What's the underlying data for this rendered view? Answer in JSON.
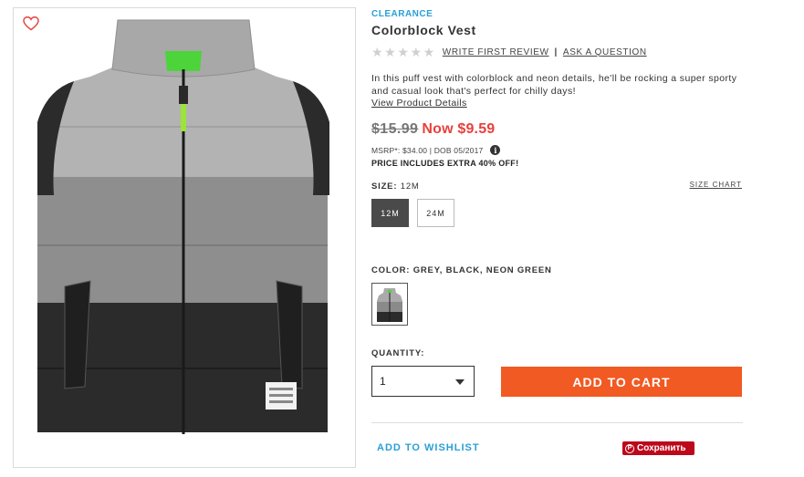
{
  "product": {
    "badge": "CLEARANCE",
    "title": "Colorblock Vest",
    "rating_stars": 0,
    "write_review": "WRITE FIRST REVIEW",
    "separator": "|",
    "ask_question": "ASK A QUESTION",
    "description": "In this puff vest with colorblock and neon details, he'll be rocking a super sporty and casual look that's perfect for chilly days!",
    "details_link": "View Product Details"
  },
  "pricing": {
    "old_price": "$15.99",
    "now_price": "Now $9.59",
    "msrp": "MSRP*: $34.00 | DOB 05/2017",
    "info_icon_glyph": "i",
    "extra": "PRICE INCLUDES EXTRA 40% OFF!"
  },
  "size": {
    "label": "SIZE:",
    "selected": "12M",
    "chart_link": "SIZE CHART",
    "options": [
      "12M",
      "24M"
    ]
  },
  "color": {
    "label": "COLOR: GREY, BLACK, NEON GREEN"
  },
  "quantity": {
    "label": "QUANTITY:",
    "value": "1"
  },
  "actions": {
    "add_to_cart": "ADD TO CART",
    "add_to_wishlist": "ADD TO WISHLIST",
    "pin_save": "Сохранить"
  },
  "icons": {
    "wishlist_heart": "heart-icon",
    "pinterest": "pinterest-icon",
    "info": "info-icon"
  },
  "colors": {
    "accent_blue": "#2a9fd6",
    "sale_red": "#e8413c",
    "cta_orange": "#f15a22",
    "pinterest_red": "#bd081c",
    "heart_red": "#e8413c"
  }
}
